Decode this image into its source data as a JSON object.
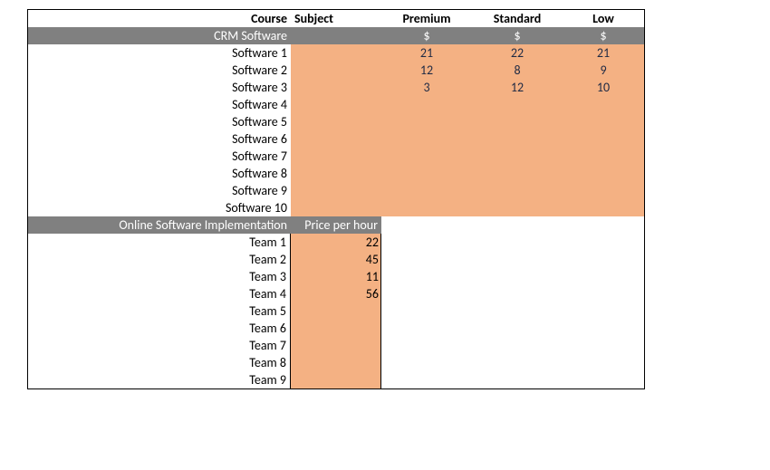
{
  "headers": {
    "course": "Course",
    "subject": "Subject",
    "premium": "Premium",
    "standard": "Standard",
    "low": "Low"
  },
  "section1": {
    "title": "CRM Software",
    "currency": {
      "premium": "$",
      "standard": "$",
      "low": "$"
    },
    "rows": [
      {
        "label": "Software 1",
        "premium": "21",
        "standard": "22",
        "low": "21"
      },
      {
        "label": "Software 2",
        "premium": "12",
        "standard": "8",
        "low": "9"
      },
      {
        "label": "Software 3",
        "premium": "3",
        "standard": "12",
        "low": "10"
      },
      {
        "label": "Software 4",
        "premium": "",
        "standard": "",
        "low": ""
      },
      {
        "label": "Software 5",
        "premium": "",
        "standard": "",
        "low": ""
      },
      {
        "label": "Software 6",
        "premium": "",
        "standard": "",
        "low": ""
      },
      {
        "label": "Software 7",
        "premium": "",
        "standard": "",
        "low": ""
      },
      {
        "label": "Software 8",
        "premium": "",
        "standard": "",
        "low": ""
      },
      {
        "label": "Software 9",
        "premium": "",
        "standard": "",
        "low": ""
      },
      {
        "label": "Software 10",
        "premium": "",
        "standard": "",
        "low": ""
      }
    ]
  },
  "section2": {
    "title": "Online Software Implementation",
    "subhead": "Price per hour",
    "rows": [
      {
        "label": "Team 1",
        "price": "22"
      },
      {
        "label": "Team 2",
        "price": "45"
      },
      {
        "label": "Team 3",
        "price": "11"
      },
      {
        "label": "Team 4",
        "price": "56"
      },
      {
        "label": "Team 5",
        "price": ""
      },
      {
        "label": "Team 6",
        "price": ""
      },
      {
        "label": "Team 7",
        "price": ""
      },
      {
        "label": "Team 8",
        "price": ""
      },
      {
        "label": "Team 9",
        "price": ""
      }
    ]
  }
}
